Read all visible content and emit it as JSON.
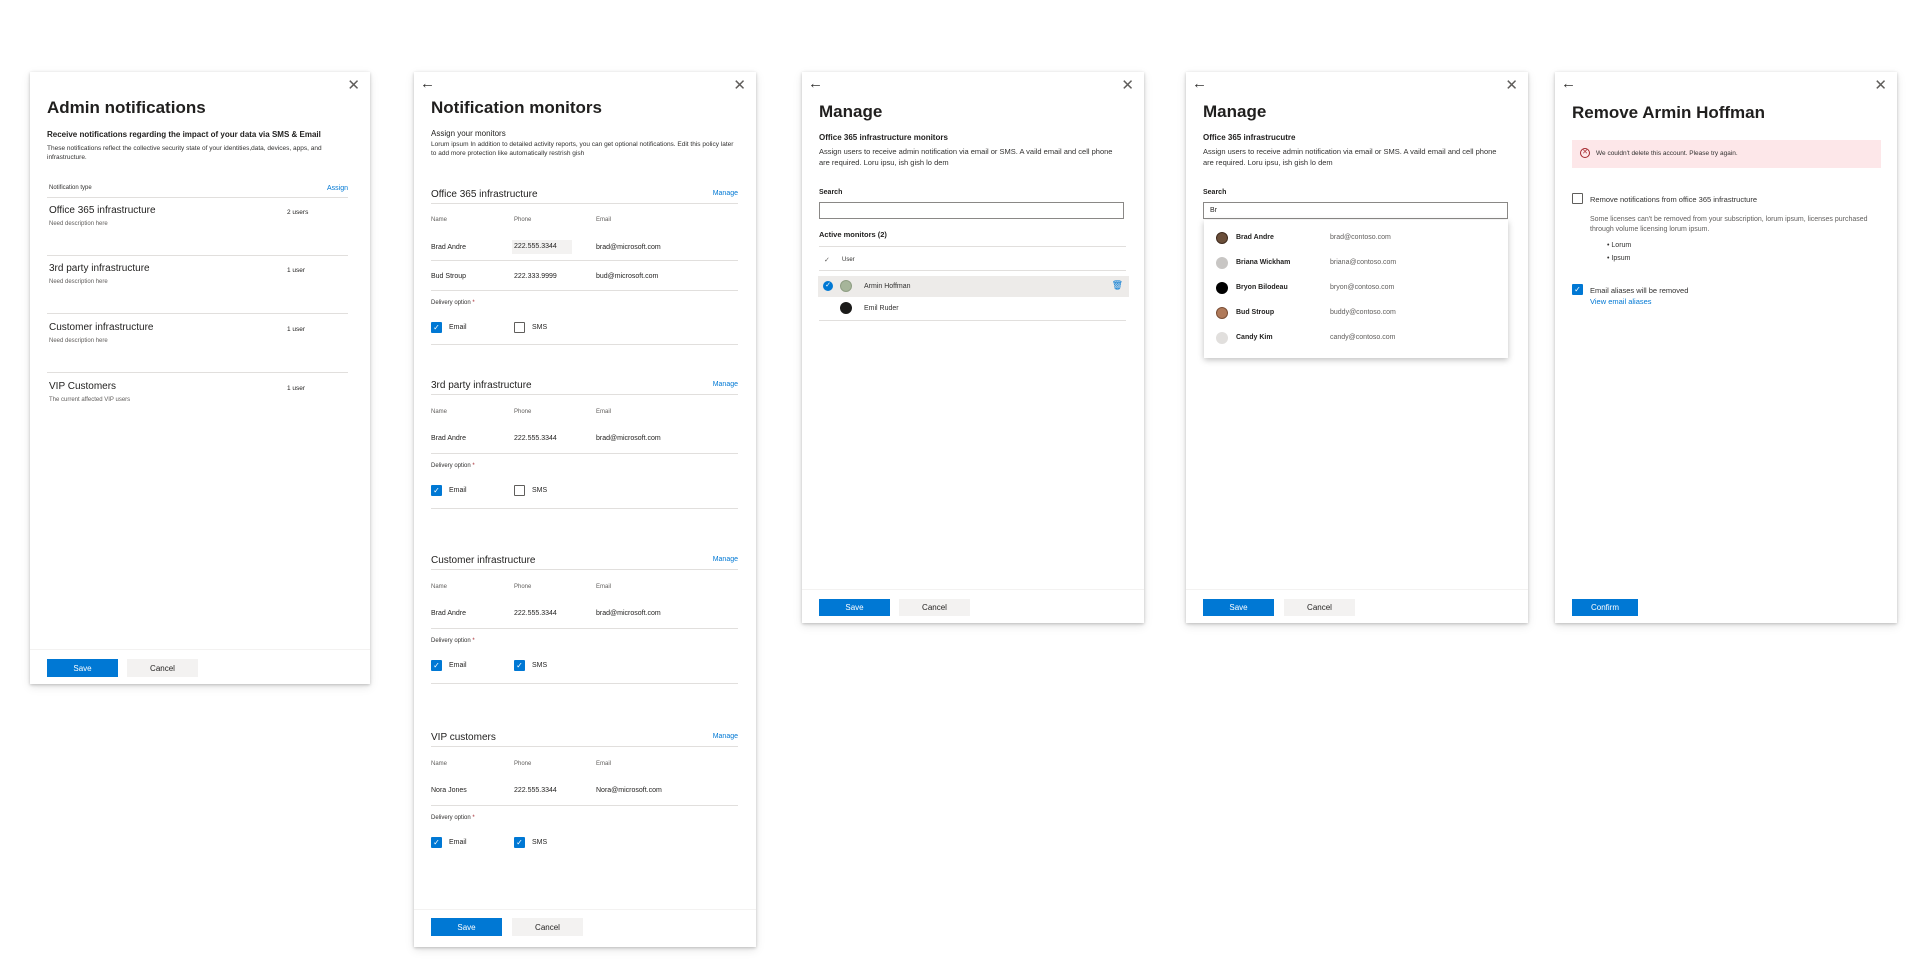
{
  "admin": {
    "title": "Admin notifications",
    "subtitle": "Receive notifications regarding the impact of your data via SMS & Email",
    "description": "These notifications reflect the collective security state of your identities,data, devices, apps, and infrastructure.",
    "col_header": "Notification type",
    "assign": "Assign",
    "items": [
      {
        "name": "Office 365 infrastructure",
        "desc": "Need description here",
        "count": "2 users"
      },
      {
        "name": "3rd party infrastructure",
        "desc": "Need description here",
        "count": "1 user"
      },
      {
        "name": "Customer infrastructure",
        "desc": "Need description here",
        "count": "1 user"
      },
      {
        "name": "VIP Customers",
        "desc": "The current affected VIP users",
        "count": "1 user"
      }
    ],
    "save": "Save",
    "cancel": "Cancel"
  },
  "monitors": {
    "title": "Notification monitors",
    "subtitle": "Assign your monitors",
    "description": "Lorum ipsum In addition to detailed activity reports, you can get optional notifications. Edit this policy later to add more protection like automatically restrish gish",
    "manage": "Manage",
    "col_name": "Name",
    "col_phone": "Phone",
    "col_email": "Email",
    "delivery": "Delivery option",
    "required": "*",
    "email_label": "Email",
    "sms_label": "SMS",
    "sections": [
      {
        "title": "Office 365 infrastructure",
        "rows": [
          {
            "name": "Brad Andre",
            "phone": "222.555.3344",
            "email": "brad@microsoft.com"
          },
          {
            "name": "Bud Stroup",
            "phone": "222.333.9999",
            "email": "bud@microsoft.com"
          }
        ]
      },
      {
        "title": "3rd party infrastructure",
        "rows": [
          {
            "name": "Brad Andre",
            "phone": "222.555.3344",
            "email": "brad@microsoft.com"
          }
        ]
      },
      {
        "title": "Customer infrastructure",
        "rows": [
          {
            "name": "Brad Andre",
            "phone": "222.555.3344",
            "email": "brad@microsoft.com"
          }
        ]
      },
      {
        "title": "VIP customers",
        "rows": [
          {
            "name": "Nora Jones",
            "phone": "222.555.3344",
            "email": "Nora@microsoft.com"
          }
        ]
      }
    ],
    "save": "Save",
    "cancel": "Cancel"
  },
  "manage1": {
    "title": "Manage",
    "subtitle": "Office 365 infrastructure monitors",
    "description": "Assign users to receive admin notification via email or SMS. A vaild email and cell phone are required. Loru ipsu, ish gish lo dem",
    "search_label": "Search",
    "search_value": "",
    "active_label": "Active monitors (2)",
    "col_user": "User",
    "users": [
      "Armin Hoffman",
      "Emil Ruder"
    ],
    "save": "Save",
    "cancel": "Cancel"
  },
  "manage2": {
    "title": "Manage",
    "subtitle": "Office 365 infrastrucutre",
    "description": "Assign users to receive admin notification via email or SMS. A vaild email and cell phone are required. Loru ipsu, ish gish lo dem",
    "search_label": "Search",
    "search_value": "Br",
    "results": [
      {
        "name": "Brad Andre",
        "email": "brad@contoso.com"
      },
      {
        "name": "Briana Wickham",
        "email": "briana@contoso.com"
      },
      {
        "name": "Bryon Bilodeau",
        "email": "bryon@contoso.com"
      },
      {
        "name": "Bud Stroup",
        "email": "buddy@contoso.com"
      },
      {
        "name": "Candy Kim",
        "email": "candy@contoso.com"
      }
    ],
    "save": "Save",
    "cancel": "Cancel"
  },
  "remove": {
    "title": "Remove Armin Hoffman",
    "error": "We couldn't delete this account. Please try again.",
    "opt1": "Remove notifications from office 365 infrastructure",
    "opt1_desc": "Some licenses can't be removed from your subscription, lorum ipsum, licenses purchased through volume licensing lorum ipsum.",
    "bullets": [
      "Lorum",
      "Ipsum"
    ],
    "opt2": "Email aliases will be removed",
    "view_aliases": "View email aliases",
    "confirm": "Confirm"
  },
  "colors": {
    "accent": "#0078d4",
    "error_bg": "#fde7e9",
    "error_icon": "#a4262c"
  },
  "icons": {
    "close": "close-icon",
    "back": "back-arrow-icon",
    "delete": "trash-icon",
    "check": "checkmark-icon"
  }
}
